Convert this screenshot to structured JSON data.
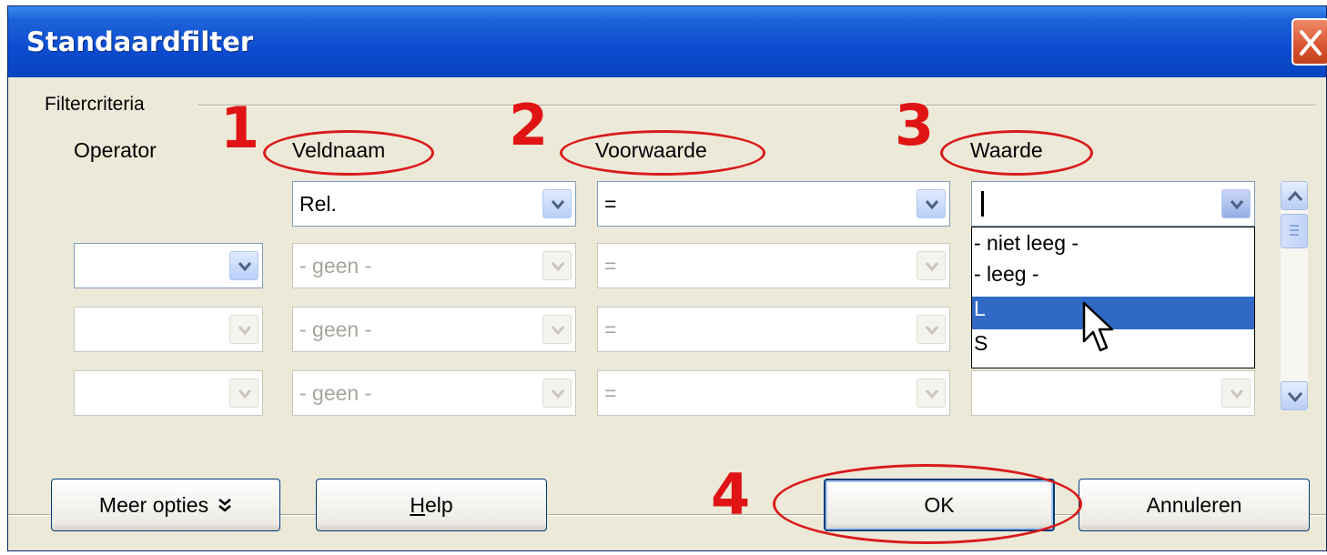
{
  "window": {
    "title": "Standaardfilter"
  },
  "group": {
    "label": "Filtercriteria"
  },
  "headers": {
    "operator": "Operator",
    "field": "Veldnaam",
    "condition": "Voorwaarde",
    "value": "Waarde"
  },
  "annotations": [
    "1",
    "2",
    "3",
    "4"
  ],
  "rows": [
    {
      "operator": "",
      "field": "Rel.",
      "condition": "=",
      "value": ""
    },
    {
      "operator": "",
      "field": "- geen -",
      "condition": "=",
      "value": ""
    },
    {
      "operator": "",
      "field": "- geen -",
      "condition": "=",
      "value": ""
    },
    {
      "operator": "",
      "field": "- geen -",
      "condition": "=",
      "value": ""
    }
  ],
  "value_dropdown": {
    "options": [
      "- niet leeg -",
      "- leeg -",
      "L",
      "S"
    ],
    "selected": "L"
  },
  "buttons": {
    "more": "Meer opties",
    "help_h": "H",
    "help_rest": "elp",
    "ok": "OK",
    "cancel": "Annuleren"
  },
  "colors": {
    "annotation": "#e01414",
    "selection": "#316ac5",
    "titlebar": "#0b4ccf"
  }
}
